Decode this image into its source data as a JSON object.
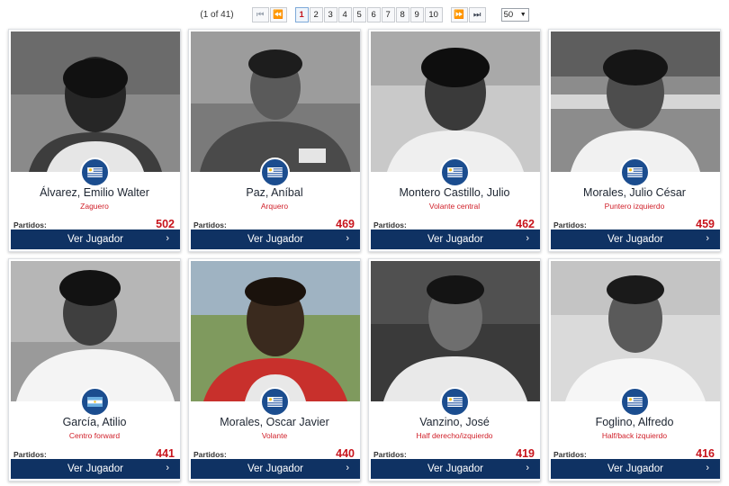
{
  "pagination": {
    "info": "(1 of 41)",
    "first_icon": "first-page-icon",
    "prev_icon": "prev-page-icon",
    "next_icon": "next-page-icon",
    "last_icon": "last-page-icon",
    "pages": [
      "1",
      "2",
      "3",
      "4",
      "5",
      "6",
      "7",
      "8",
      "9",
      "10"
    ],
    "active_page": "1",
    "per_page": "50",
    "colors": {
      "active": "#c4141c",
      "border": "#c9ccd1"
    }
  },
  "players": [
    {
      "name": "Álvarez, Emilio Walter",
      "position": "Zaguero",
      "matches_label": "Partidos:",
      "matches": "502",
      "button": "Ver Jugador",
      "flag": "uruguay-flag-icon"
    },
    {
      "name": "Paz, Aníbal",
      "position": "Arquero",
      "matches_label": "Partidos:",
      "matches": "469",
      "button": "Ver Jugador",
      "flag": "uruguay-flag-icon"
    },
    {
      "name": "Montero Castillo, Julio",
      "position": "Volante central",
      "matches_label": "Partidos:",
      "matches": "462",
      "button": "Ver Jugador",
      "flag": "uruguay-flag-icon"
    },
    {
      "name": "Morales, Julio César",
      "position": "Puntero izquierdo",
      "matches_label": "Partidos:",
      "matches": "459",
      "button": "Ver Jugador",
      "flag": "uruguay-flag-icon"
    },
    {
      "name": "García, Atilio",
      "position": "Centro forward",
      "matches_label": "Partidos:",
      "matches": "441",
      "button": "Ver Jugador",
      "flag": "argentina-flag-icon"
    },
    {
      "name": "Morales, Oscar Javier",
      "position": "Volante",
      "matches_label": "Partidos:",
      "matches": "440",
      "button": "Ver Jugador",
      "flag": "uruguay-flag-icon"
    },
    {
      "name": "Vanzino, José",
      "position": "Half derecho/izquierdo",
      "matches_label": "Partidos:",
      "matches": "419",
      "button": "Ver Jugador",
      "flag": "uruguay-flag-icon"
    },
    {
      "name": "Foglino, Alfredo",
      "position": "Half/back izquierdo",
      "matches_label": "Partidos:",
      "matches": "416",
      "button": "Ver Jugador",
      "flag": "uruguay-flag-icon"
    }
  ],
  "colors": {
    "button_bg": "#0f3263",
    "badge_bg": "#1b4d8f",
    "position_text": "#d0202a",
    "matches_value": "#c8141c",
    "uruguay_blue": "#2f5fa8",
    "argentina_blue": "#6aaee0"
  }
}
